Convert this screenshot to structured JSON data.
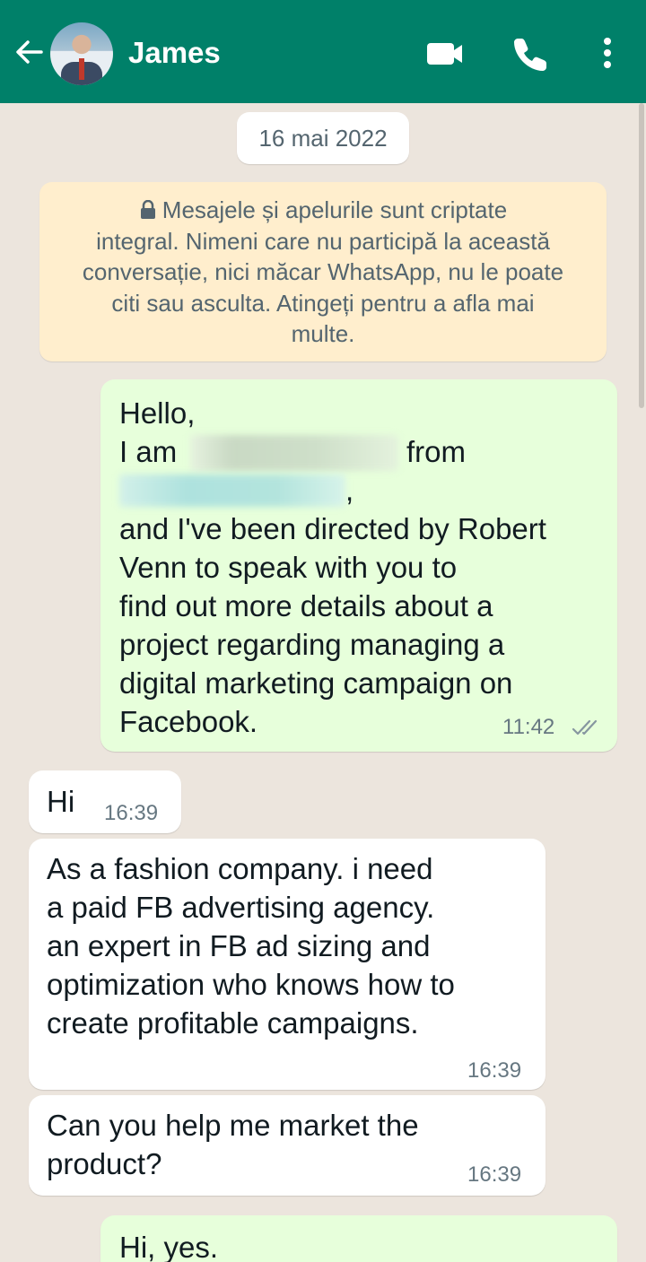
{
  "header": {
    "contact_name": "James",
    "icons": [
      "back-arrow-icon",
      "avatar",
      "video-call-icon",
      "voice-call-icon",
      "more-options-icon"
    ],
    "colors": {
      "bar": "#008069",
      "foreground": "#ffffff"
    }
  },
  "chat": {
    "date_separator": "16 mai 2022",
    "encryption_notice": "Mesajele și apelurile sunt criptate integral. Nimeni care nu participă la această conversație, nici măcar WhatsApp, nu le poate citi sau asculta. Atingeți pentru a afla mai multe.",
    "encryption_notice_lines": [
      "Mesajele și apelurile sunt criptate",
      "integral. Nimeni care nu participă la această",
      "conversație, nici măcar WhatsApp, nu le poate",
      "citi sau asculta. Atingeți pentru a afla mai",
      "multe."
    ],
    "messages": [
      {
        "direction": "outgoing",
        "lines": [
          "Hello,",
          "I am",
          "from",
          ",",
          "and I've been directed by Robert",
          "Venn to speak with you to",
          "find out more details about a",
          "project regarding managing a",
          "digital marketing campaign on",
          "Facebook."
        ],
        "time": "11:42",
        "status": "read-double-check"
      },
      {
        "direction": "incoming",
        "text": "Hi",
        "time": "16:39"
      },
      {
        "direction": "incoming",
        "lines": [
          "As a fashion company. i need",
          "a paid FB advertising agency.",
          "an expert in FB ad sizing and",
          "optimization who knows how to",
          "create profitable campaigns."
        ],
        "time": "16:39"
      },
      {
        "direction": "incoming",
        "lines": [
          "Can you help me market the",
          "product?"
        ],
        "time": "16:39"
      },
      {
        "direction": "outgoing",
        "text": "Hi, yes."
      }
    ],
    "colors": {
      "outgoing_bubble": "#e7ffdb",
      "incoming_bubble": "#ffffff",
      "background": "#ece5dd",
      "notice": "#ffeecd"
    }
  }
}
